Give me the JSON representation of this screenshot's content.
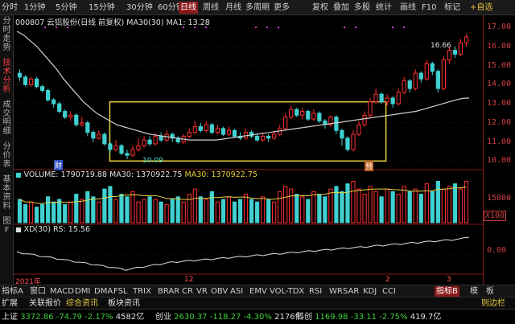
{
  "toolbar": {
    "items": [
      "分时",
      "1分钟",
      "5分钟",
      "15分钟",
      "30分钟",
      "60分钟",
      "日线",
      "周线",
      "月线",
      "多周期",
      "更多"
    ],
    "active": "日线",
    "right": [
      "复权",
      "叠加",
      "多股",
      "统计",
      "画线",
      "F10",
      "标记",
      "+自选"
    ]
  },
  "side_tabs": [
    {
      "label": "分时走势",
      "active": false
    },
    {
      "label": "技术分析",
      "active": true
    },
    {
      "label": "成交明细",
      "active": false
    },
    {
      "label": "分价表",
      "active": false
    },
    {
      "label": "基本资料",
      "active": false
    },
    {
      "label": "图F",
      "active": false
    }
  ],
  "header": {
    "code": "000807",
    "name": "云铝股份(日线 前复权)",
    "ma_label": "MA30(30)",
    "ma_value": "MA1: 13.28"
  },
  "volume_header": {
    "label": "VOLUME: 1790719.88",
    "ma30": "MA30: 1370922.75",
    "ma30b": "MA30: 1370922.75"
  },
  "xd_header": {
    "label": "XD(30)",
    "rs": "RS: 15.56"
  },
  "price_axis": [
    "17.00",
    "16.00",
    "15.00",
    "14.00",
    "13.00",
    "12.00",
    "11.00",
    "10.00"
  ],
  "volume_axis": [
    "15000"
  ],
  "volume_unit": "X100",
  "xd_axis": [
    "0.00"
  ],
  "annotations": {
    "high": "16.66",
    "low": "10.09",
    "cai": "财",
    "jin": "预"
  },
  "dates": {
    "y2021": "2021年",
    "m12": "12",
    "m2": "2",
    "m3": "3"
  },
  "bottom_tabs": {
    "indicators": [
      "指标A",
      "窗口",
      "MACD",
      "DMI",
      "DMA",
      "FSL",
      "TRIX",
      "BRAR",
      "CR",
      "VR",
      "OBV",
      "ASI",
      "EMV",
      "VOL-TDX",
      "RSI",
      "WR",
      "SAR",
      "KDJ",
      "CCI"
    ],
    "right": [
      "指标B",
      "模",
      "板"
    ]
  },
  "status_tabs": {
    "items": [
      "扩展",
      "关联报价",
      "综合资讯",
      "板块资讯"
    ],
    "right": "则边栏"
  },
  "index_bar": [
    {
      "name": "上证",
      "value": "3372.86",
      "chg": "-74.79",
      "pct": "-2.17%",
      "vol": "4582亿"
    },
    {
      "name": "创业",
      "value": "2630.37",
      "chg": "-118.27",
      "pct": "-4.30%",
      "vol": "2176亿"
    },
    {
      "name": "科创",
      "value": "1169.98",
      "chg": "-33.11",
      "pct": "-2.75%",
      "vol": "419.7亿"
    }
  ],
  "chart_data": {
    "type": "candlestick",
    "price_ylim": [
      9.8,
      17.3
    ],
    "candles": [
      [
        14.6,
        14.4,
        14.8,
        14.2
      ],
      [
        14.4,
        14.0,
        14.5,
        13.9
      ],
      [
        14.0,
        14.3,
        14.4,
        13.9
      ],
      [
        14.3,
        13.9,
        14.4,
        13.8
      ],
      [
        13.9,
        13.7,
        14.0,
        13.6
      ],
      [
        13.7,
        13.2,
        13.8,
        13.1
      ],
      [
        13.2,
        13.0,
        13.3,
        12.8
      ],
      [
        13.0,
        12.6,
        13.1,
        12.5
      ],
      [
        12.6,
        12.3,
        12.7,
        12.2
      ],
      [
        12.3,
        12.4,
        12.6,
        12.1
      ],
      [
        12.4,
        11.9,
        12.5,
        11.8
      ],
      [
        11.9,
        12.0,
        12.3,
        11.8
      ],
      [
        12.0,
        11.5,
        12.1,
        11.3
      ],
      [
        11.5,
        11.2,
        11.6,
        11.0
      ],
      [
        11.2,
        11.4,
        11.6,
        11.1
      ],
      [
        11.4,
        10.9,
        11.5,
        10.8
      ],
      [
        10.9,
        10.6,
        11.0,
        10.4
      ],
      [
        10.6,
        10.8,
        11.1,
        10.5
      ],
      [
        10.8,
        10.4,
        10.9,
        10.3
      ],
      [
        10.4,
        10.3,
        10.6,
        10.1
      ],
      [
        10.3,
        10.6,
        10.8,
        10.2
      ],
      [
        10.6,
        10.8,
        11.2,
        10.5
      ],
      [
        10.8,
        11.1,
        11.3,
        10.7
      ],
      [
        11.1,
        10.9,
        11.3,
        10.8
      ],
      [
        10.9,
        11.3,
        11.5,
        10.8
      ],
      [
        11.3,
        11.1,
        11.5,
        11.0
      ],
      [
        11.1,
        11.4,
        11.6,
        11.0
      ],
      [
        11.4,
        11.2,
        11.5,
        11.0
      ],
      [
        11.2,
        11.0,
        11.3,
        10.9
      ],
      [
        11.0,
        11.3,
        11.4,
        10.9
      ],
      [
        11.3,
        11.5,
        11.7,
        11.2
      ],
      [
        11.5,
        11.8,
        12.1,
        11.4
      ],
      [
        11.8,
        11.6,
        12.0,
        11.5
      ],
      [
        11.6,
        11.9,
        12.1,
        11.5
      ],
      [
        11.9,
        11.5,
        12.0,
        11.4
      ],
      [
        11.5,
        11.7,
        11.9,
        11.4
      ],
      [
        11.7,
        11.4,
        11.8,
        11.3
      ],
      [
        11.4,
        11.6,
        11.8,
        11.3
      ],
      [
        11.6,
        11.3,
        11.7,
        11.2
      ],
      [
        11.3,
        11.2,
        11.5,
        11.1
      ],
      [
        11.2,
        11.5,
        11.7,
        11.1
      ],
      [
        11.5,
        11.3,
        11.6,
        11.2
      ],
      [
        11.3,
        11.1,
        11.4,
        11.0
      ],
      [
        11.1,
        11.3,
        11.5,
        11.0
      ],
      [
        11.3,
        11.2,
        11.4,
        11.0
      ],
      [
        11.2,
        11.4,
        11.6,
        11.1
      ],
      [
        11.4,
        11.7,
        11.9,
        11.3
      ],
      [
        11.7,
        12.3,
        12.5,
        11.6
      ],
      [
        12.3,
        12.7,
        12.9,
        12.2
      ],
      [
        12.7,
        12.4,
        12.8,
        12.3
      ],
      [
        12.4,
        12.6,
        12.8,
        12.2
      ],
      [
        12.6,
        12.2,
        12.7,
        12.1
      ],
      [
        12.2,
        12.5,
        12.7,
        12.1
      ],
      [
        12.5,
        12.1,
        12.6,
        12.0
      ],
      [
        12.1,
        11.9,
        12.2,
        11.7
      ],
      [
        11.9,
        12.3,
        12.4,
        11.8
      ],
      [
        12.3,
        11.6,
        12.4,
        11.4
      ],
      [
        11.6,
        11.2,
        11.7,
        10.8
      ],
      [
        11.2,
        10.6,
        11.3,
        10.5
      ],
      [
        10.6,
        11.4,
        11.6,
        10.5
      ],
      [
        11.4,
        11.9,
        12.1,
        11.3
      ],
      [
        11.9,
        12.4,
        12.6,
        11.8
      ],
      [
        12.4,
        13.1,
        13.3,
        12.3
      ],
      [
        13.1,
        13.5,
        13.8,
        13.0
      ],
      [
        13.5,
        13.1,
        13.6,
        13.0
      ],
      [
        13.1,
        13.3,
        13.5,
        12.9
      ],
      [
        13.3,
        13.0,
        13.4,
        12.8
      ],
      [
        13.0,
        13.6,
        13.8,
        12.9
      ],
      [
        13.6,
        14.2,
        14.4,
        13.5
      ],
      [
        14.2,
        13.8,
        14.3,
        13.6
      ],
      [
        13.8,
        14.6,
        14.8,
        13.7
      ],
      [
        14.6,
        14.3,
        14.7,
        14.1
      ],
      [
        14.3,
        15.1,
        15.3,
        14.2
      ],
      [
        15.1,
        14.7,
        15.2,
        14.5
      ],
      [
        14.7,
        13.8,
        14.8,
        13.6
      ],
      [
        13.8,
        15.3,
        15.5,
        13.7
      ],
      [
        15.3,
        15.8,
        16.0,
        15.1
      ],
      [
        15.8,
        15.6,
        16.0,
        15.4
      ],
      [
        15.6,
        16.2,
        16.4,
        15.5
      ],
      [
        16.2,
        16.5,
        16.66,
        16.0
      ]
    ],
    "ma30": [
      16.8,
      16.6,
      16.3,
      16.0,
      15.6,
      15.2,
      14.8,
      14.3,
      13.9,
      13.5,
      13.1,
      12.8,
      12.5,
      12.3,
      12.1,
      11.9,
      11.8,
      11.7,
      11.6,
      11.5,
      11.4,
      11.35,
      11.3,
      11.25,
      11.2,
      11.15,
      11.1,
      11.1,
      11.1,
      11.1,
      11.1,
      11.15,
      11.2,
      11.25,
      11.3,
      11.35,
      11.4,
      11.45,
      11.5,
      11.55,
      11.6,
      11.65,
      11.7,
      11.75,
      11.8,
      11.85,
      11.9,
      11.95,
      12.0,
      12.05,
      12.1,
      12.15,
      12.2,
      12.25,
      12.3,
      12.35,
      12.4,
      12.45,
      12.5,
      12.55,
      12.6,
      12.7,
      12.8,
      12.9,
      13.0,
      13.1,
      13.2,
      13.28,
      13.3
    ],
    "volume": [
      9,
      7,
      8,
      6,
      7,
      10,
      8,
      9,
      7,
      8,
      11,
      9,
      12,
      10,
      8,
      13,
      14,
      9,
      11,
      10,
      12,
      8,
      9,
      10,
      9,
      8,
      7,
      9,
      10,
      8,
      11,
      13,
      10,
      9,
      12,
      8,
      9,
      10,
      8,
      9,
      11,
      9,
      8,
      10,
      9,
      8,
      12,
      14,
      13,
      11,
      10,
      9,
      12,
      11,
      10,
      13,
      14,
      12,
      15,
      16,
      13,
      11,
      14,
      12,
      10,
      13,
      12,
      11,
      14,
      12,
      13,
      11,
      15,
      12,
      16,
      13,
      14,
      15,
      13,
      16
    ],
    "volume_ylim": [
      0,
      18
    ],
    "xd": [
      0.2,
      0.1,
      0.0,
      -0.1,
      -0.2,
      -0.3,
      -0.4,
      -0.5,
      -0.6,
      -0.7,
      -0.8,
      -0.9,
      -1.0,
      -1.1,
      -1.2,
      -1.3,
      -1.4,
      -1.5,
      -1.6,
      -1.7,
      -1.6,
      -1.5,
      -1.4,
      -1.3,
      -1.2,
      -1.1,
      -1.0,
      -0.9,
      -0.85,
      -0.8,
      -0.75,
      -0.7,
      -0.65,
      -0.6,
      -0.55,
      -0.5,
      -0.45,
      -0.4,
      -0.35,
      -0.3,
      -0.25,
      -0.2,
      -0.15,
      -0.1,
      -0.05,
      0.0,
      0.05,
      0.1,
      0.15,
      0.2,
      0.25,
      0.3,
      0.35,
      0.4,
      0.45,
      0.5,
      0.55,
      0.6,
      0.65,
      0.7,
      0.75,
      0.8,
      0.85,
      0.9,
      0.95,
      1.0,
      1.05,
      1.1,
      1.15,
      1.2,
      1.25,
      1.3,
      1.35,
      1.4,
      1.45,
      1.5,
      1.55,
      1.6,
      1.7,
      1.9
    ],
    "xd_ylim": [
      -2.0,
      2.2
    ],
    "highlight_box": {
      "from_index": 17,
      "to_index": 64
    },
    "colors": {
      "up": "#ff3030",
      "down": "#40d0d0",
      "ma": "#d0d0d0",
      "box": "#e8d040",
      "vol_ma": "#e8d040"
    }
  }
}
